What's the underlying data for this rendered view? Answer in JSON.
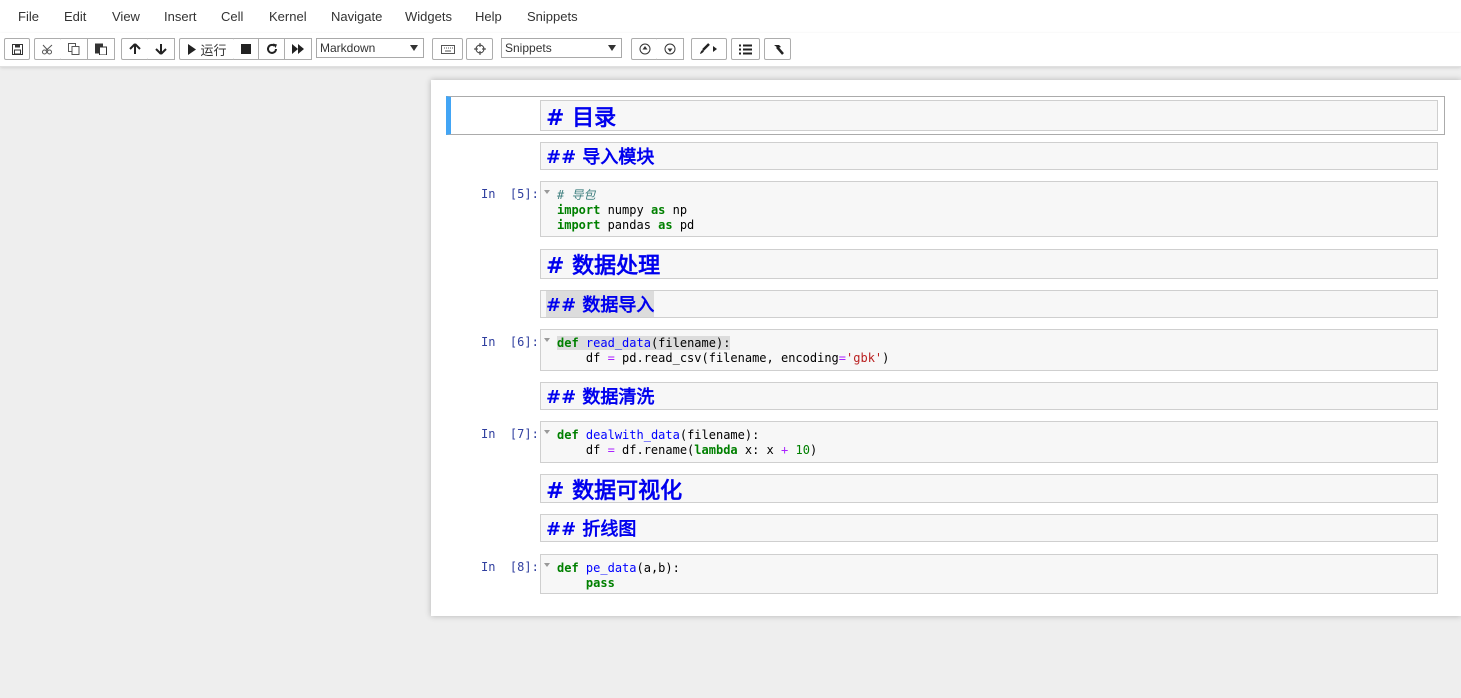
{
  "menu": {
    "file": "File",
    "edit": "Edit",
    "view": "View",
    "insert": "Insert",
    "cell": "Cell",
    "kernel": "Kernel",
    "navigate": "Navigate",
    "widgets": "Widgets",
    "help": "Help",
    "snippets": "Snippets"
  },
  "toolbar": {
    "run_label": "运行",
    "cell_type": "Markdown",
    "snippets_select": "Snippets",
    "icons": [
      "save-icon",
      "cut-icon",
      "copy-icon",
      "paste-icon",
      "arrow-up-icon",
      "arrow-down-icon",
      "play-icon",
      "stop-icon",
      "restart-icon",
      "fast-forward-icon",
      "keyboard-icon",
      "crosshair-icon",
      "snippet-icon",
      "circle-arrow-up-icon",
      "circle-arrow-down-icon",
      "paintbrush-icon",
      "list-icon",
      "hammer-icon"
    ]
  },
  "cells": {
    "md_toc": "# 目录",
    "md_import": "## 导入模块",
    "code1_prompt": "In  [5]:",
    "code1_comment": "# 导包",
    "code1_kw1": "import",
    "code1_mod1": " numpy ",
    "code1_as1": "as",
    "code1_alias1": " np",
    "code1_kw2": "import",
    "code1_mod2": " pandas ",
    "code1_as2": "as",
    "code1_alias2": " pd",
    "md_dataproc": "# 数据处理",
    "md_import_data": "## 数据导入",
    "code2_prompt": "In  [6]:",
    "code2_def": "def",
    "code2_fname": "read_data",
    "code2_params": "(filename):",
    "code2_line2_a": "    df ",
    "code2_line2_eq": "=",
    "code2_line2_b": " pd.read_csv(filename, encoding",
    "code2_line2_eq2": "=",
    "code2_line2_str": "'gbk'",
    "code2_line2_c": ")",
    "md_clean": "## 数据清洗",
    "code3_prompt": "In  [7]:",
    "code3_def": "def",
    "code3_fname": "dealwith_data",
    "code3_params": "(filename):",
    "code3_line2_a": "    df ",
    "code3_line2_eq": "=",
    "code3_line2_b": " df.rename(",
    "code3_line2_lambda": "lambda",
    "code3_line2_c": " x: x ",
    "code3_line2_plus": "+",
    "code3_line2_num": " 10",
    "code3_line2_d": ")",
    "md_vis": "# 数据可视化",
    "md_line": "## 折线图",
    "code4_prompt": "In  [8]:",
    "code4_def": "def",
    "code4_fname": "pe_data",
    "code4_params": "(a,b):",
    "code4_indent": "    ",
    "code4_pass": "pass"
  },
  "colors": {
    "markdown_heading": "#0000ee",
    "selected_cell_bar": "#42a5f5",
    "prompt": "#303f9f",
    "keyword": "#008000"
  }
}
